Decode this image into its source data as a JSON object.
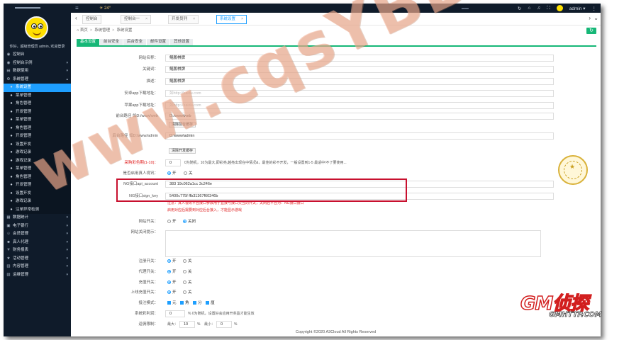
{
  "sidebar": {
    "welcome": "你好，超级管理员 admin, 欢迎登录",
    "items": [
      {
        "icon": "dashboard-icon",
        "glyph": "◉",
        "label": "控制台",
        "arrow": ""
      },
      {
        "icon": "console-icon",
        "glyph": "◉",
        "label": "控制台示例",
        "arrow": "▾"
      },
      {
        "icon": "data-icon",
        "glyph": "▤",
        "label": "数据使用",
        "arrow": "▾"
      },
      {
        "icon": "system-icon",
        "glyph": "⚙",
        "label": "系统管理",
        "arrow": "▴"
      },
      {
        "icon": "dot-icon",
        "glyph": "●",
        "label": "系统设置",
        "arrow": "",
        "active": true
      },
      {
        "icon": "dot-icon",
        "glyph": "●",
        "label": "菜单管理",
        "arrow": ""
      },
      {
        "icon": "dot-icon",
        "glyph": "●",
        "label": "角色管理",
        "arrow": ""
      },
      {
        "icon": "dot-icon",
        "glyph": "●",
        "label": "开发管理",
        "arrow": ""
      },
      {
        "icon": "dot-icon",
        "glyph": "●",
        "label": "菜单管理",
        "arrow": ""
      },
      {
        "icon": "dot-icon",
        "glyph": "●",
        "label": "角色管理",
        "arrow": ""
      },
      {
        "icon": "dot-icon",
        "glyph": "●",
        "label": "开发管理",
        "arrow": ""
      },
      {
        "icon": "dot-icon",
        "glyph": "●",
        "label": "设置开发",
        "arrow": ""
      },
      {
        "icon": "dot-icon",
        "glyph": "●",
        "label": "游戏记录",
        "arrow": ""
      },
      {
        "icon": "dot-icon",
        "glyph": "●",
        "label": "游戏记录",
        "arrow": ""
      },
      {
        "icon": "dot-icon",
        "glyph": "●",
        "label": "菜单管理",
        "arrow": ""
      },
      {
        "icon": "dot-icon",
        "glyph": "●",
        "label": "角色管理",
        "arrow": ""
      },
      {
        "icon": "dot-icon",
        "glyph": "●",
        "label": "开发管理",
        "arrow": ""
      },
      {
        "icon": "dot-icon",
        "glyph": "●",
        "label": "设置开发",
        "arrow": ""
      },
      {
        "icon": "dot-icon",
        "glyph": "●",
        "label": "游戏记录",
        "arrow": ""
      },
      {
        "icon": "dot-icon",
        "glyph": "●",
        "label": "注单异常检测",
        "arrow": ""
      },
      {
        "icon": "stats-icon",
        "glyph": "▦",
        "label": "数据统计",
        "arrow": "▾"
      },
      {
        "icon": "bank-icon",
        "glyph": "▣",
        "label": "电子银行",
        "arrow": "▾"
      },
      {
        "icon": "user-icon",
        "glyph": "☺",
        "label": "会员管理",
        "arrow": "▾"
      },
      {
        "icon": "agent-icon",
        "glyph": "☻",
        "label": "真人代理",
        "arrow": "▾"
      },
      {
        "icon": "finance-icon",
        "glyph": "¥",
        "label": "财务报表",
        "arrow": "▾"
      },
      {
        "icon": "event-icon",
        "glyph": "★",
        "label": "活动管理",
        "arrow": "▾"
      },
      {
        "icon": "content-icon",
        "glyph": "▥",
        "label": "内容管理",
        "arrow": "▾"
      },
      {
        "icon": "log-icon",
        "glyph": "▧",
        "label": "运维管理",
        "arrow": "▾"
      }
    ]
  },
  "topbar": {
    "weather": "☀ 24°",
    "user": "admin ▾"
  },
  "tabs": [
    {
      "label": "控制台"
    },
    {
      "label": "控制台一"
    },
    {
      "label": "开发员列"
    },
    {
      "label": "系统设置",
      "active": true
    }
  ],
  "breadcrumb": [
    "首页",
    "系统管理",
    "系统设置"
  ],
  "content_tabs": [
    "基本设置",
    "前台安全",
    "后台安全",
    "邮件设置",
    "其他设置"
  ],
  "form": {
    "site_name_label": "网站名称：",
    "site_name": "鲲鹏棋牌",
    "keywords_label": "关键词：",
    "keywords": "鲲鹏棋牌",
    "desc_label": "描述：",
    "desc": "鲲鹏棋牌",
    "android_label": "安卓app下载地址：",
    "android_placeholder": "如http://baidu.com",
    "ios_label": "苹果app下载地址：",
    "ios_placeholder": "如http://baidu.com",
    "front_path_label": "前台路径 如D:/www/web",
    "front_path": "D:/www/web",
    "front_clear": "清除前台缓存",
    "admin_path_label": "后台路径 如D:/www/admin",
    "admin_path": "D:\\www\\admin",
    "admin_clear": "清除开发缓存",
    "color_label": "采购彩色期(1-10)：",
    "color_value": "0",
    "color_hint": "0为随机，10为最大,即彩亮,越亮出现在中情况&，最佳的彩不开发，一般设置到1-5 最适中!不了要使用...",
    "realname_label": "是否启用真人视讯：",
    "realname_on": "开",
    "realname_off": "关",
    "ng_account_label": "NG接口api_account",
    "ng_account": "383          19c062a1cc          3c246e",
    "ng_key_label": "NG接口sign_key",
    "ng_key": "5400c775f          ffb31367f60346b",
    "notice_1": "注意：真人视讯平台接口参数用于直接与接口交互的开关，关闭后平台为：NG接口接口",
    "notice_2": "启用对应后需要到对应后台接入，才能显示游戏",
    "switch_label": "网站开关：",
    "switch_on": "开",
    "switch_off": "关闭",
    "close_msg_label": "网站关闭提示：",
    "r1_label": "注册开关：",
    "r2_label": "代理开关：",
    "r3_label": "充值开关：",
    "r4_label": "上线充值开关：",
    "r_on": "开",
    "r_off": "关",
    "bet_mode_label": "投注模式：",
    "bet_modes": [
      "元",
      "角",
      "分",
      "厘"
    ],
    "rebate_label": "系统彩利润：",
    "rebate_value": "0",
    "rebate_hint": "%  0为随机，设置好会应用开奖盈才能生效",
    "limit_label": "返佣限制：",
    "limit_max_label": "最大：",
    "limit_max": "10",
    "limit_min_label": "最小：",
    "limit_min": "0",
    "limit_unit": "%"
  },
  "footer": "Copyright ©2020 A3Cloud All Rights Reserved",
  "watermark": "www.cqsYBB.com",
  "logo": {
    "big": "GM侦探",
    "small": "GMHTTP.COM"
  }
}
